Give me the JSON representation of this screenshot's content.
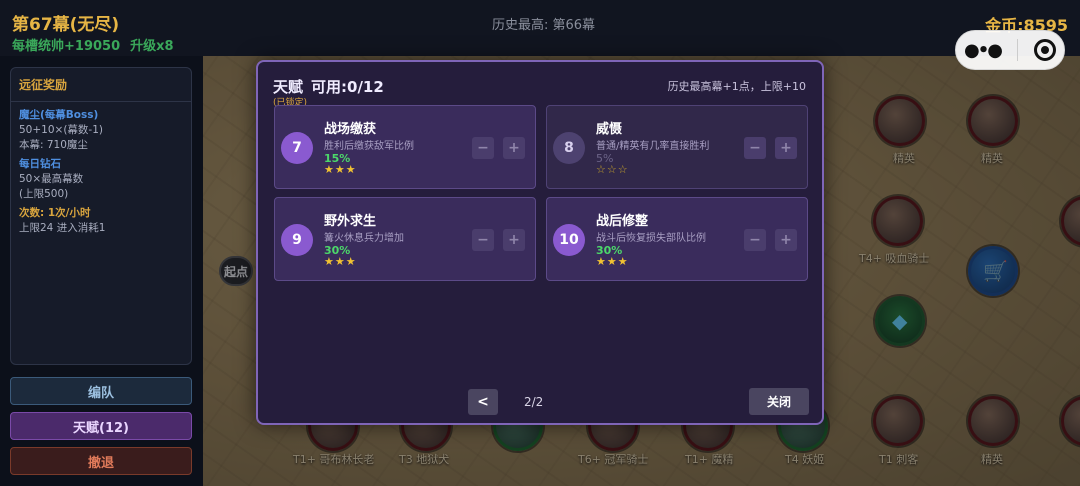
{
  "header": {
    "stage_title": "第67幕(无尽)",
    "per_slot_commander": "每槽统帅+19050",
    "upgrade": "升级x8",
    "history_best": "历史最高: 第66幕",
    "gold": "金币:8595"
  },
  "left_panel": {
    "title": "远征奖励",
    "lines": [
      {
        "text": "魔尘(每幕Boss)",
        "style": "h"
      },
      {
        "text": "50+10×(幕数-1)",
        "style": "n"
      },
      {
        "text": "本幕: 710魔尘",
        "style": "n"
      },
      {
        "text": "每日钻石",
        "style": "h"
      },
      {
        "text": "50×最高幕数",
        "style": "n"
      },
      {
        "text": "(上限500)",
        "style": "n"
      },
      {
        "text": "次数: 1次/小时",
        "style": "y"
      },
      {
        "text": "上限24 进入消耗1",
        "style": "n"
      }
    ]
  },
  "buttons": {
    "team": "编队",
    "talent": "天赋(12)",
    "retreat": "撤退"
  },
  "map": {
    "start_label": "起点",
    "labels": [
      "精英",
      "T4+ 吸血骑士",
      "T1+ 哥布林长老",
      "T3 地狱犬",
      "T6+ 冠军骑士",
      "T1+ 魔精",
      "T4 妖姬",
      "T1 刺客",
      "精英",
      "精英"
    ]
  },
  "dialog": {
    "title": "天赋",
    "available": "可用:0/12",
    "locked_note": "(已锁定)",
    "rule": "历史最高幕+1点，上限+10",
    "talents": [
      {
        "num": "7",
        "name": "战场缴获",
        "desc": "胜利后缴获敌军比例",
        "value": "15%",
        "stars": "★★★",
        "minus": "−",
        "plus": "+"
      },
      {
        "num": "8",
        "name": "威慑",
        "desc": "普通/精英有几率直接胜利",
        "value": "5%",
        "stars": "☆☆☆",
        "minus": "−",
        "plus": "+"
      },
      {
        "num": "9",
        "name": "野外求生",
        "desc": "篝火休息兵力增加",
        "value": "30%",
        "stars": "★★★",
        "minus": "−",
        "plus": "+"
      },
      {
        "num": "10",
        "name": "战后修整",
        "desc": "战斗后恢复损失部队比例",
        "value": "30%",
        "stars": "★★★",
        "minus": "−",
        "plus": "+"
      }
    ],
    "prev": "<",
    "page": "2/2",
    "close": "关闭"
  },
  "colors": {
    "accent_gold": "#e6b545",
    "accent_green": "#3aa85a",
    "dialog_border": "#7f65b8",
    "talent_number": "#8a5ad0"
  },
  "icons": [
    "more-dots-icon",
    "target-icon",
    "diamond-icon",
    "shop-cart-icon"
  ]
}
